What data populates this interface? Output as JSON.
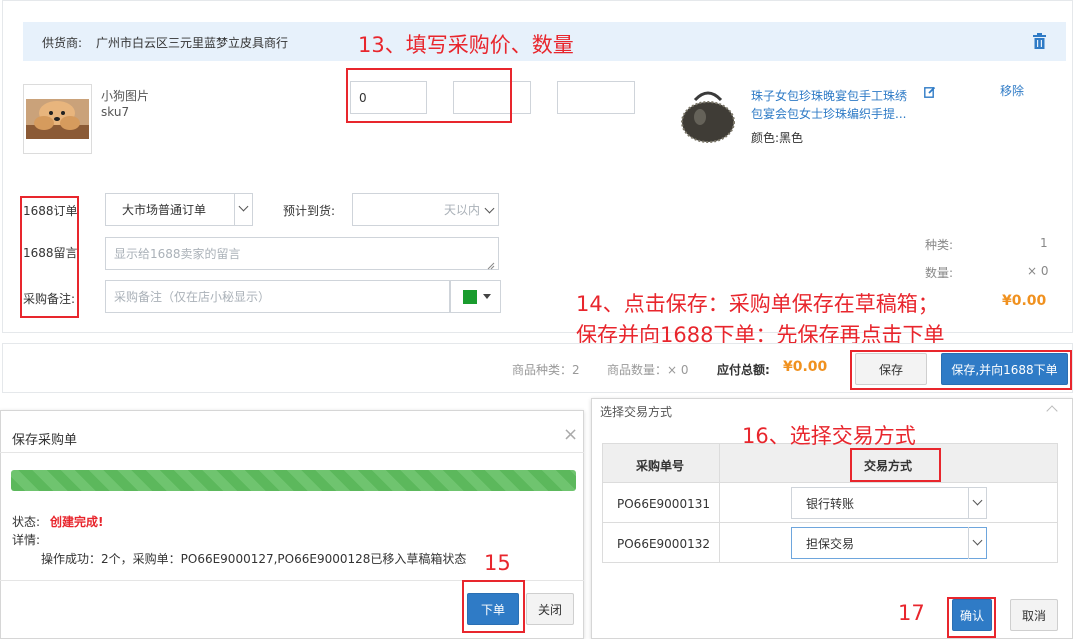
{
  "supplier": {
    "label": "供货商:",
    "name": "广州市白云区三元里蓝梦立皮具商行"
  },
  "annotations": {
    "step13": "13、填写采购价、数量",
    "step14_line1": "14、点击保存：采购单保存在草稿箱；",
    "step14_line2": "保存并向1688下单：先保存再点击下单",
    "step15": "15",
    "step16": "16、选择交易方式",
    "step17": "17"
  },
  "item": {
    "image_title": "小狗图片",
    "sku": "sku7",
    "price_value": "0",
    "product_title_line1": "珠子女包珍珠晚宴包手工珠绣",
    "product_title_line2": "包宴会包女士珍珠编织手提...",
    "color_label": "颜色:黑色",
    "remove_label": "移除"
  },
  "order_form": {
    "order_label": "1688订单",
    "order_type": "大市场普通订单",
    "arrival_label": "预计到货:",
    "arrival_value": "天以内",
    "message_label": "1688留言",
    "message_placeholder": "显示给1688卖家的留言",
    "remark_label": "采购备注:",
    "remark_placeholder": "采购备注（仅在店小秘显示）",
    "flag_color": "#1a9c2e"
  },
  "summary": {
    "kinds_label": "种类:",
    "kinds_value": "1",
    "qty_label": "数量:",
    "qty_value": "× 0",
    "total_value": "¥0.00"
  },
  "footer": {
    "kinds_text": "商品种类：2",
    "qty_text": "商品数量：× 0",
    "payable_label": "应付总额:",
    "payable_value": "¥0.00",
    "save_label": "保存",
    "save_order_label": "保存,并向1688下单"
  },
  "save_dialog": {
    "title": "保存采购单",
    "close_glyph": "×",
    "progress": 1.0,
    "status_label": "状态:",
    "status_value": "创建完成!",
    "detail_label": "详情:",
    "detail_text": "操作成功：2个，采购单：PO66E9000127,PO66E9000128已移入草稿箱状态",
    "order_button": "下单",
    "close_button": "关闭"
  },
  "trade_dialog": {
    "title": "选择交易方式",
    "col_order": "采购单号",
    "col_method": "交易方式",
    "rows": [
      {
        "order_no": "PO66E9000131",
        "method": "银行转账"
      },
      {
        "order_no": "PO66E9000132",
        "method": "担保交易"
      }
    ],
    "confirm_button": "确认",
    "cancel_button": "取消"
  },
  "colors": {
    "accent": "#2f7bc6",
    "annotation": "#e8262d",
    "price": "#f0911f",
    "status_red": "#e8262d"
  }
}
